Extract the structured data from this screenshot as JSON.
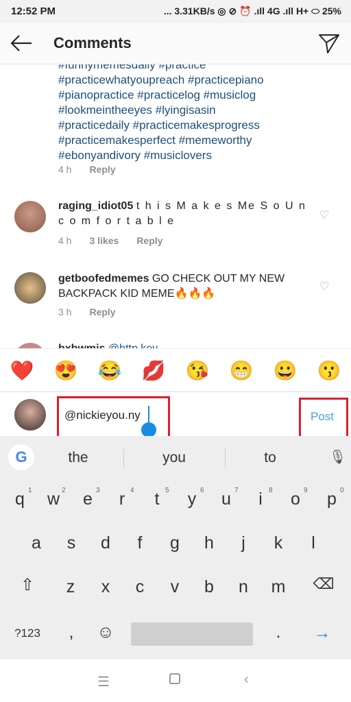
{
  "status": {
    "time": "12:52 PM",
    "right": "... 3.31KB/s ◎ ⊘ ⏰ .ıll 4G .ıll H+ ⬭ 25%"
  },
  "header": {
    "title": "Comments",
    "back_icon": "arrow-left-icon",
    "share_icon": "send-icon"
  },
  "caption": {
    "partial_top": "#funnymemesdaily #practice",
    "lines": [
      "#practicewhatyoupreach #practicepiano",
      "#pianopractice #practicelog #musiclog",
      "#lookmeintheeyes #lyingisasin",
      "#practicedaily #practicemakesprogress",
      "#practicemakesperfect #memeworthy",
      "#ebonyandivory #musiclovers"
    ],
    "time": "4 h",
    "reply": "Reply"
  },
  "comments": [
    {
      "user": "raging_idiot05",
      "text": "t h i s  M a k e s  Me  S o  U n c o m f o r t a b l e",
      "time": "4 h",
      "likes": "3 likes",
      "reply": "Reply"
    },
    {
      "user": "getboofedmemes",
      "text": "GO CHECK OUT MY NEW BACKPACK KID MEME🔥🔥🔥",
      "time": "3 h",
      "reply": "Reply"
    },
    {
      "user": "bxbwmjs",
      "text": "@http.key"
    }
  ],
  "emojis": [
    "❤️",
    "😍",
    "😂",
    "💋",
    "😘",
    "😁",
    "😀",
    "😗"
  ],
  "input": {
    "value": "@nickieyou.ny",
    "post": "Post"
  },
  "keyboard": {
    "suggestions": [
      "the",
      "you",
      "to"
    ],
    "row1": [
      "q",
      "w",
      "e",
      "r",
      "t",
      "y",
      "u",
      "i",
      "o",
      "p"
    ],
    "row1_nums": [
      "1",
      "2",
      "3",
      "4",
      "5",
      "6",
      "7",
      "8",
      "9",
      "0"
    ],
    "row2": [
      "a",
      "s",
      "d",
      "f",
      "g",
      "h",
      "j",
      "k",
      "l"
    ],
    "row3": [
      "z",
      "x",
      "c",
      "v",
      "b",
      "n",
      "m"
    ],
    "sym": "?123",
    "comma": ",",
    "period": "."
  }
}
